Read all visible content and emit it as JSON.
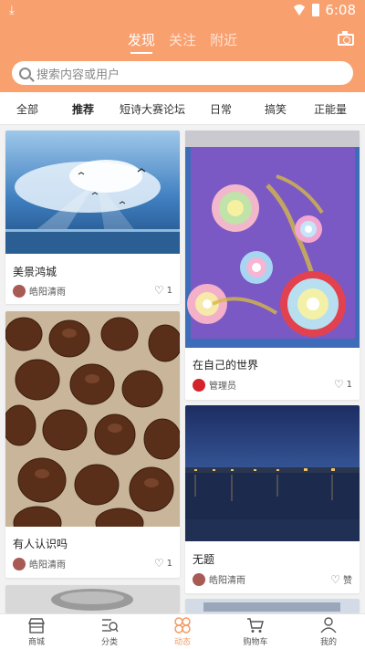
{
  "status_bar": {
    "time": "6:08"
  },
  "header": {
    "tabs": [
      {
        "label": "发现",
        "active": true
      },
      {
        "label": "关注",
        "active": false
      },
      {
        "label": "附近",
        "active": false
      }
    ],
    "search_placeholder": "搜索内容或用户"
  },
  "categories": [
    {
      "label": "全部",
      "active": false
    },
    {
      "label": "推荐",
      "active": true
    },
    {
      "label": "短诗大赛论坛",
      "active": false
    },
    {
      "label": "日常",
      "active": false
    },
    {
      "label": "搞笑",
      "active": false
    },
    {
      "label": "正能量",
      "active": false
    }
  ],
  "posts": [
    {
      "title": "美景鸿城",
      "author": "皓阳清雨",
      "likes": "1"
    },
    {
      "title": "在自己的世界",
      "author": "管理员",
      "likes": "1"
    },
    {
      "title": "有人认识吗",
      "author": "皓阳清雨",
      "likes": "1"
    },
    {
      "title": "无题",
      "author": "皓阳清雨",
      "likes": "赞"
    }
  ],
  "bottom_nav": [
    {
      "label": "商城",
      "icon": "store-icon"
    },
    {
      "label": "分类",
      "icon": "category-icon"
    },
    {
      "label": "动态",
      "icon": "moments-icon",
      "active": true
    },
    {
      "label": "购物车",
      "icon": "cart-icon"
    },
    {
      "label": "我的",
      "icon": "profile-icon"
    }
  ],
  "colors": {
    "header_bg": "#f9a06f",
    "accent": "#f39a65"
  }
}
